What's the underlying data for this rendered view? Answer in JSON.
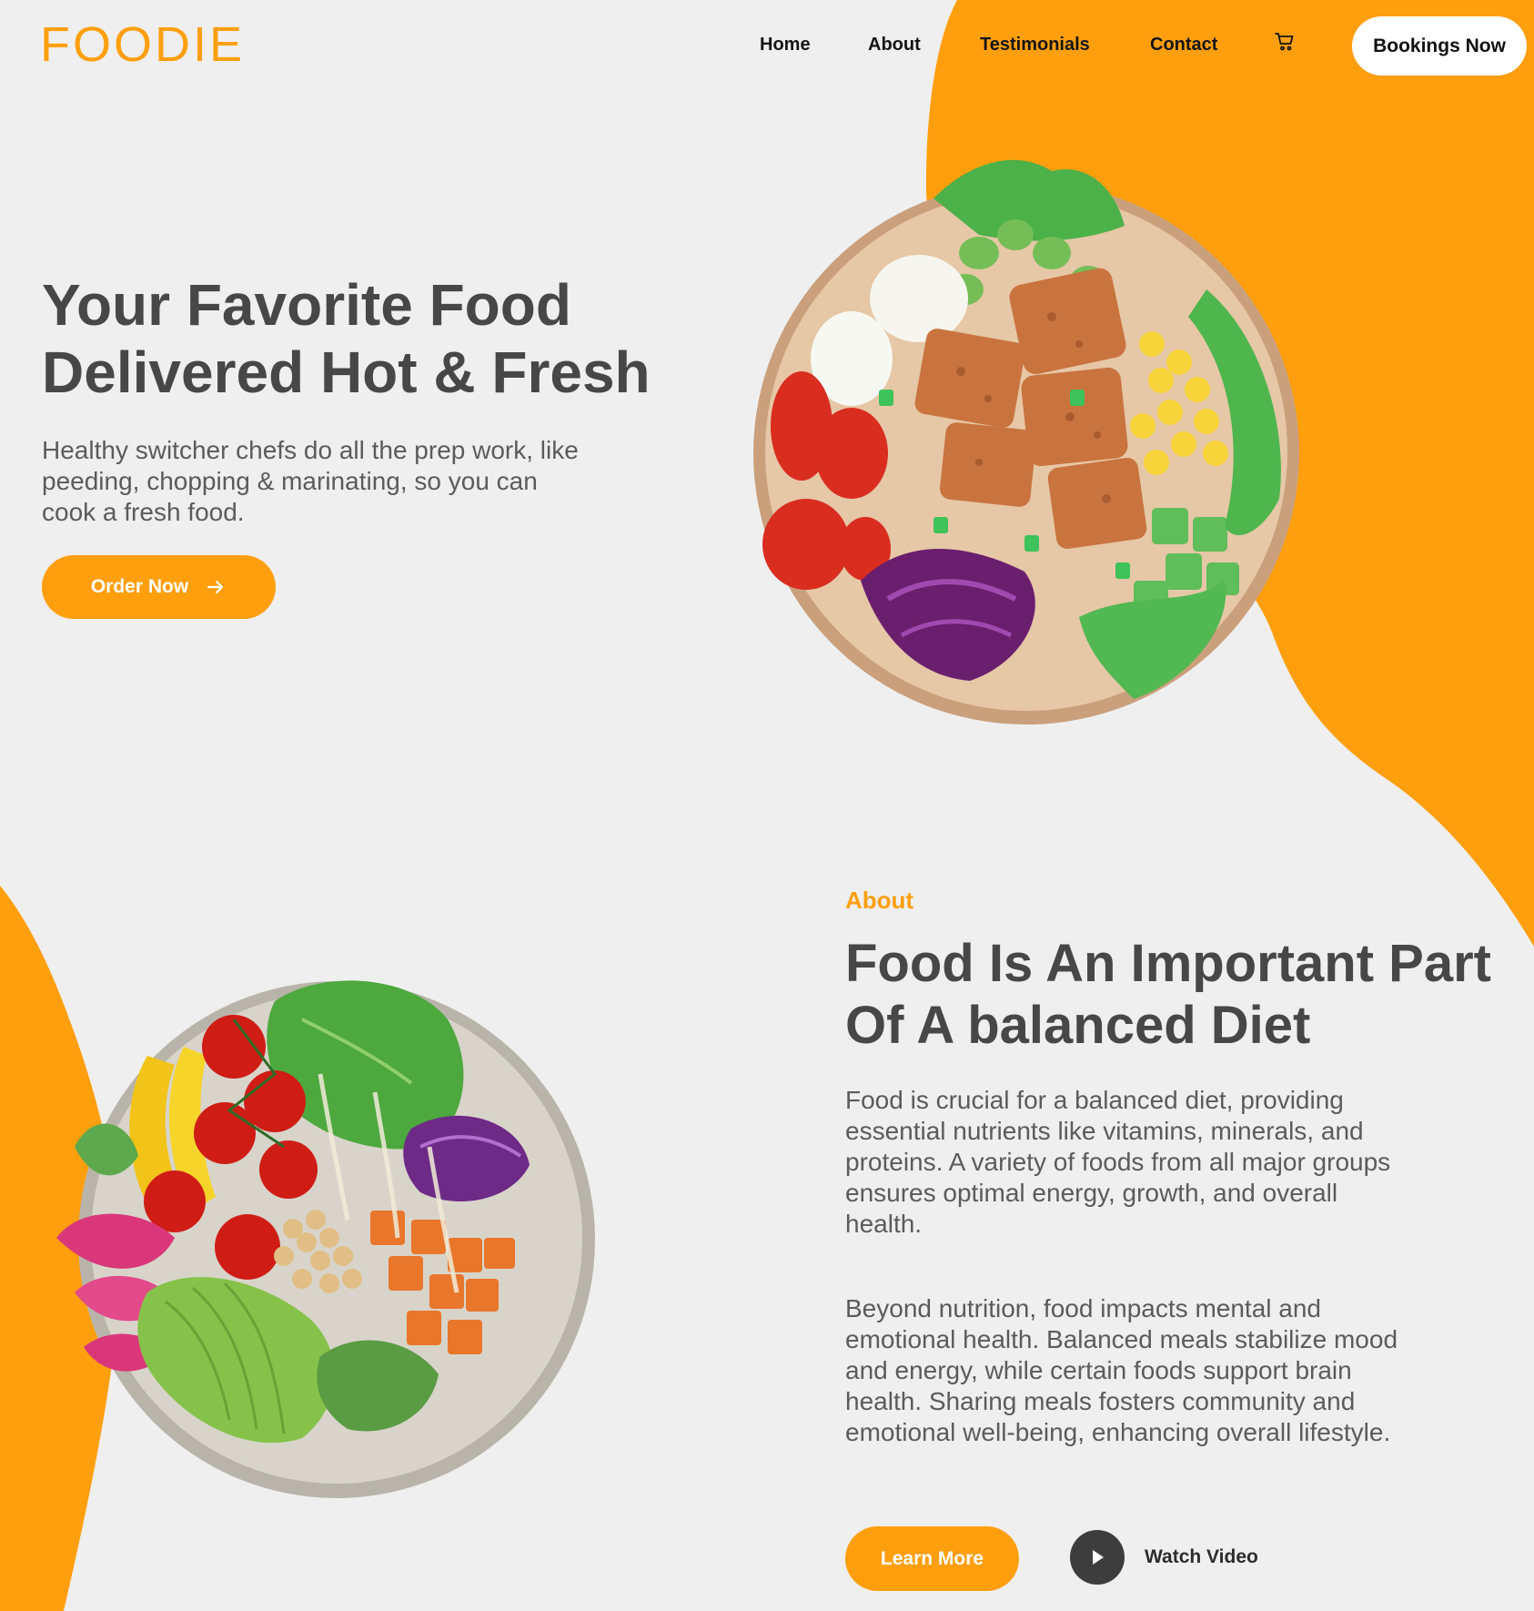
{
  "brand": {
    "logo": "FOODIE",
    "accent": "#ff9f0e"
  },
  "nav": {
    "items": [
      "Home",
      "About",
      "Testimonials",
      "Contact"
    ],
    "cart_icon": "cart-icon",
    "booking_label": "Bookings Now"
  },
  "hero": {
    "title": "Your Favorite Food Delivered Hot & Fresh",
    "subtitle": "Healthy switcher chefs do all the prep work, like peeding, chopping & marinating, so you can cook a fresh food.",
    "cta_label": "Order Now",
    "cta_icon": "arrow-right-icon"
  },
  "about": {
    "label": "About",
    "title": "Food Is An Important Part Of A balanced Diet",
    "paragraph1": "Food is crucial for a balanced diet, providing essential nutrients like vitamins, minerals, and proteins. A variety of foods from all major groups ensures optimal energy, growth, and overall health.",
    "paragraph2": "Beyond nutrition, food impacts mental and emotional health. Balanced meals stabilize mood and energy, while certain foods support brain health. Sharing meals fosters community and emotional well-being, enhancing overall lifestyle.",
    "learn_more_label": "Learn More",
    "watch_video_label": "Watch Video",
    "play_icon": "play-icon"
  },
  "colors": {
    "background": "#efefef",
    "accent": "#ff9f0e",
    "heading": "#474747",
    "body_text": "#5b5b5b",
    "dark_button": "#3d3d3d"
  }
}
